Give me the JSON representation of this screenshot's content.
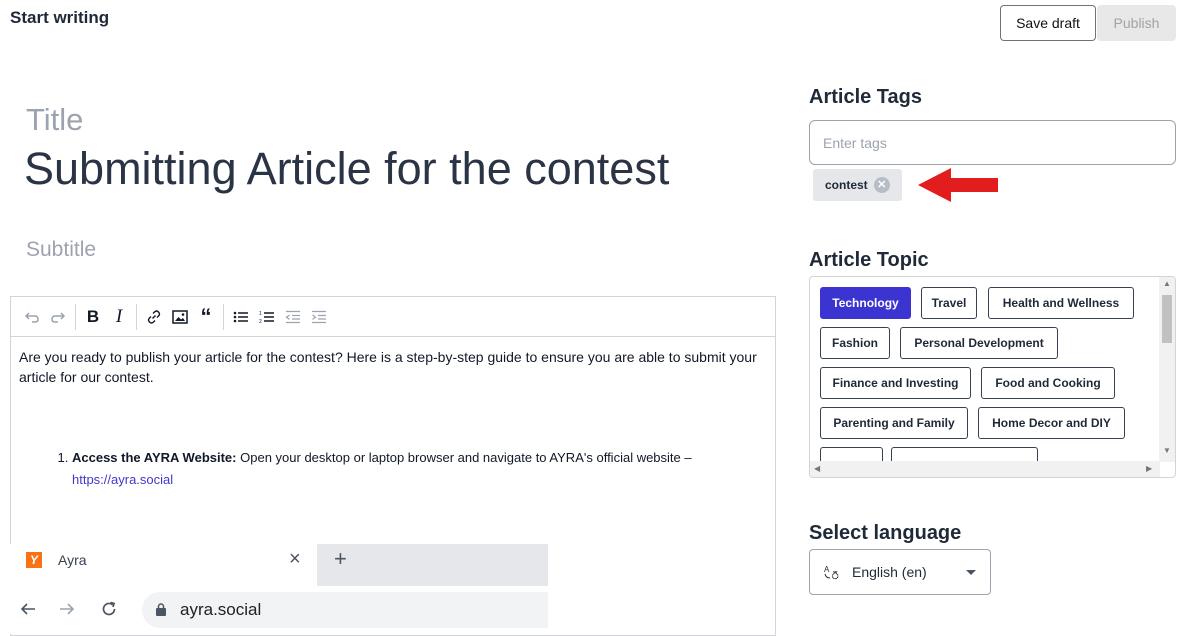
{
  "header": {
    "title": "Start writing",
    "save_draft_label": "Save draft",
    "publish_label": "Publish"
  },
  "editor": {
    "title_label": "Title",
    "title_value": "Submitting Article for the contest",
    "subtitle_placeholder": "Subtitle",
    "toolbar_icons": [
      "undo-icon",
      "redo-icon",
      "bold-icon",
      "italic-icon",
      "link-icon",
      "image-icon",
      "quote-icon",
      "bullet-list-icon",
      "numbered-list-icon",
      "outdent-icon",
      "indent-icon"
    ],
    "toolbar_text": {
      "bold": "B",
      "italic": "I",
      "quote": "“"
    },
    "paragraph": "Are you ready to publish your article for the contest?  Here is a step-by-step guide to ensure you are able to submit your article for our contest.",
    "list_items": [
      {
        "number": "1",
        "bold_lead": "Access the AYRA Website:",
        "text": "Open your desktop or laptop browser and navigate to AYRA's official website –",
        "link": "https://ayra.social"
      }
    ],
    "embedded_screenshot": {
      "tab_title": "Ayra",
      "tab_close": "×",
      "new_tab": "+",
      "url": "ayra.social",
      "logo_letter": "Y"
    }
  },
  "tags": {
    "heading": "Article Tags",
    "input_placeholder": "Enter tags",
    "chips": [
      {
        "label": "contest"
      }
    ],
    "annotation_color": "#e11d1d"
  },
  "topics": {
    "heading": "Article Topic",
    "items": [
      {
        "label": "Technology",
        "selected": true
      },
      {
        "label": "Travel",
        "selected": false
      },
      {
        "label": "Health and Wellness",
        "selected": false
      },
      {
        "label": "Fashion",
        "selected": false
      },
      {
        "label": "Personal Development",
        "selected": false
      },
      {
        "label": "Finance and Investing",
        "selected": false
      },
      {
        "label": "Food and Cooking",
        "selected": false
      },
      {
        "label": "Parenting and Family",
        "selected": false
      },
      {
        "label": "Home Decor and DIY",
        "selected": false
      }
    ],
    "accent_color": "#3b34d1"
  },
  "language": {
    "heading": "Select language",
    "selected": "English (en)",
    "icon": "translate-icon"
  }
}
